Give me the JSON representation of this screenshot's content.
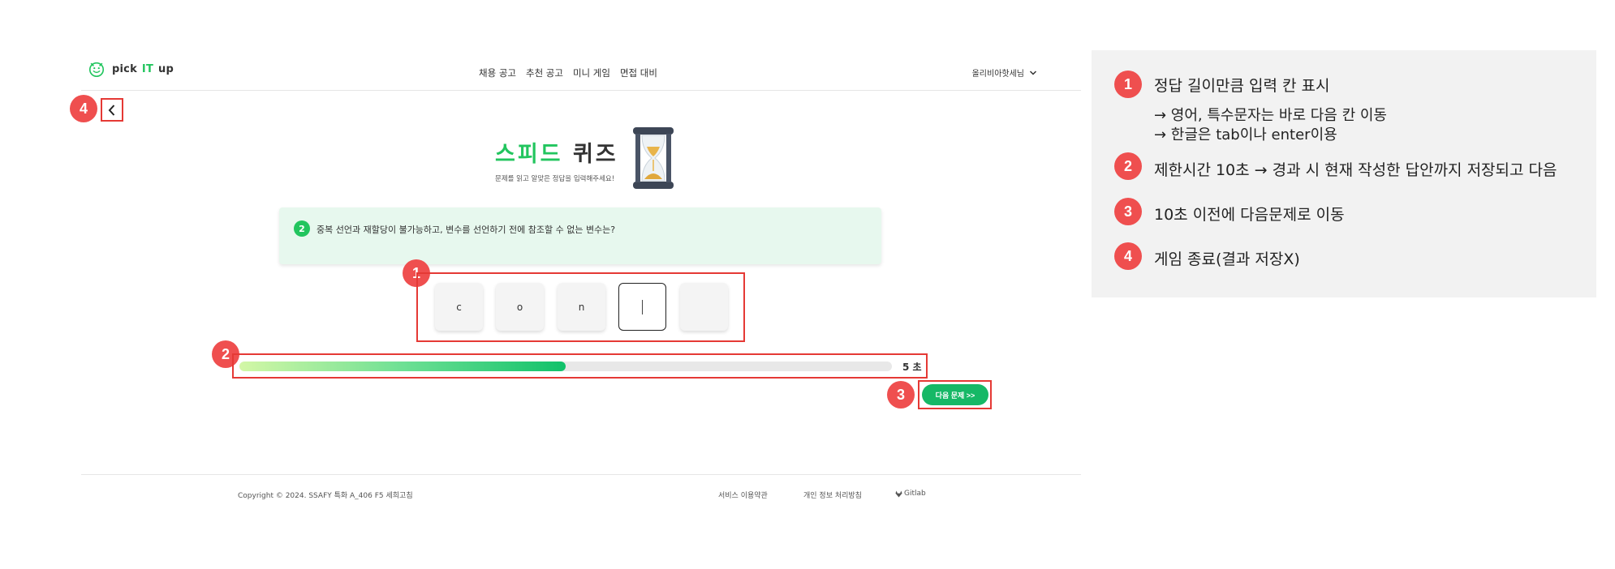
{
  "header": {
    "logo_prefix": "pick",
    "logo_highlight": "IT",
    "logo_suffix": "up",
    "nav": [
      "채용 공고",
      "추천 공고",
      "미니 게임",
      "면접 대비"
    ],
    "user_name": "올리비아핫세님"
  },
  "quiz": {
    "title_accent": "스피드",
    "title_main": "퀴즈",
    "subtitle": "문제를 읽고 알맞은 정답을 입력해주세요!",
    "question_number": "2",
    "question_text": "중복 선언과 재할당이 불가능하고, 변수를 선언하기 전에 참조할 수 없는 변수는?",
    "answer_cells": [
      "c",
      "o",
      "n",
      "",
      ""
    ],
    "active_cell_index": 3,
    "timer_fraction": 0.5,
    "timer_text": "5 초",
    "next_label": "다음 문제 >>"
  },
  "footer": {
    "copyright": "Copyright © 2024. SSAFY 특화 A_406 F5 세희고침",
    "terms": "서비스 이용약관",
    "privacy": "개인 정보 처리방침",
    "gitlab": "Gitlab"
  },
  "badges": [
    "1",
    "2",
    "3",
    "4"
  ],
  "annotations": {
    "item1": "정답 길이만큼 입력 칸 표시",
    "item1_sub1": "→ 영어, 특수문자는 바로 다음 칸 이동",
    "item1_sub2": "→ 한글은 tab이나 enter이용",
    "item2": "제한시간 10초 → 경과 시 현재 작성한 답안까지 저장되고 다음",
    "item3": "10초 이전에 다음문제로 이동",
    "item4": "게임 종료(결과 저장X)"
  },
  "colors": {
    "accent": "#22c55e",
    "badge": "#ef4f4f",
    "highlight_border": "#e53935",
    "question_bg": "#e7f8ee",
    "panel_bg": "#f2f2f2"
  },
  "icons": [
    "smile-logo-icon",
    "chevron-down-icon",
    "back-chevron-icon",
    "hourglass-icon",
    "gitlab-icon"
  ]
}
